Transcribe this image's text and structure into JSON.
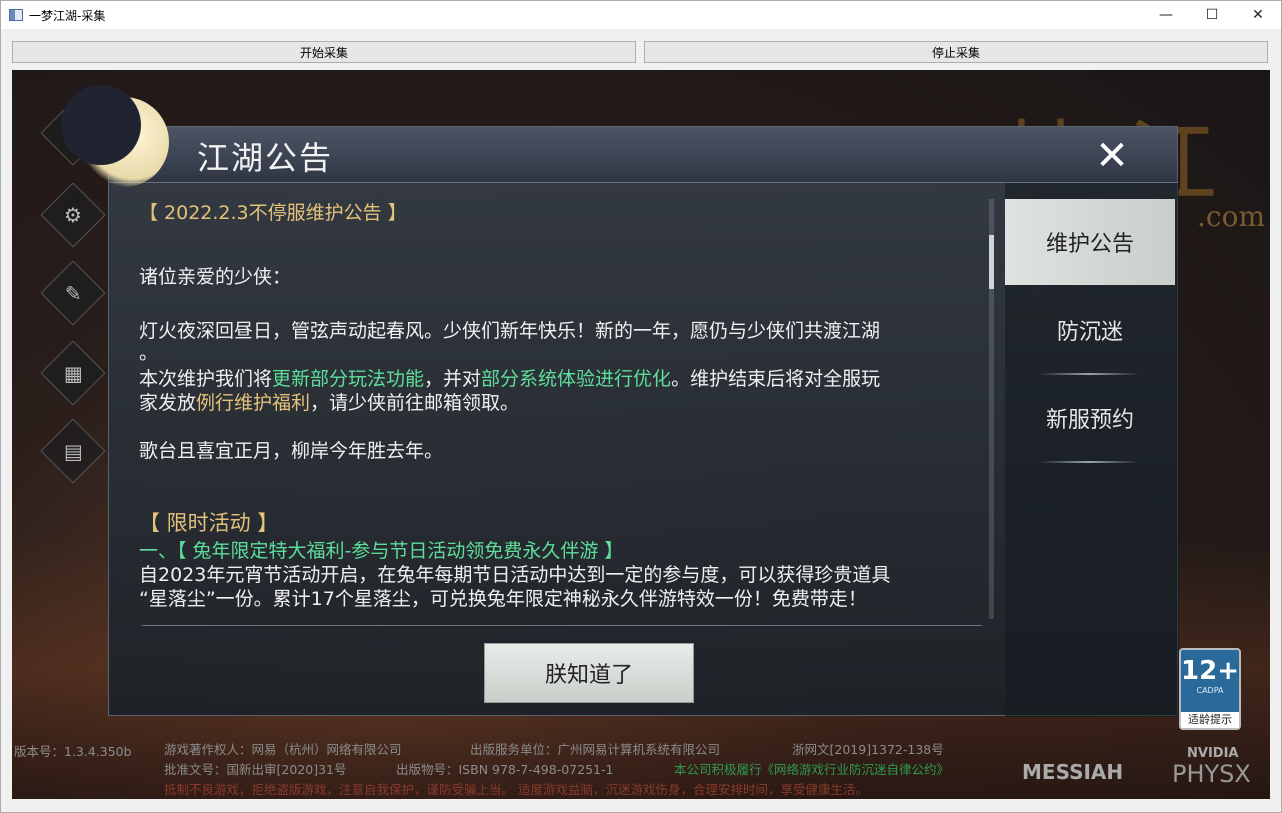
{
  "window": {
    "title": "一梦江湖-采集",
    "controls": [
      "—",
      "☐",
      "✕"
    ]
  },
  "toolbar": {
    "start_label": "开始采集",
    "stop_label": "停止采集"
  },
  "game": {
    "bg_logo": "梦江湖",
    "bg_com": ".com",
    "panel_title": "江湖公告",
    "close_label": "✕",
    "ok_label": "朕知道了",
    "tabs": [
      {
        "label": "维护公告",
        "active": true
      },
      {
        "label": "防沉迷",
        "active": false
      },
      {
        "label": "新服预约",
        "active": false
      }
    ],
    "notice": {
      "header": "【 2022.2.3不停服维护公告 】",
      "greeting": "诸位亲爱的少侠：",
      "para1": "灯火夜深回昼日，管弦声动起春风。少侠们新年快乐！新的一年，愿仍与少侠们共渡江湖",
      "para1_end": "。",
      "para2_a": "本次维护我们将",
      "para2_b": "更新部分玩法功能",
      "para2_c": "，并对",
      "para2_d": "部分系统体验进行优化",
      "para2_e": "。维护结束后将对全服玩",
      "para2_f": "家发放",
      "para2_g": "例行维护福利",
      "para2_h": "，请少侠前往邮箱领取。",
      "para3": "歌台且喜宜正月，柳岸今年胜去年。",
      "section": "【 限时活动 】",
      "sub": "一、【 兔年限定特大福利-参与节日活动领免费永久伴游 】",
      "body1": "自2023年元宵节活动开启，在兔年每期节日活动中达到一定的参与度，可以获得珍贵道具",
      "body2": "“星落尘”一份。累计17个星落尘，可兑换兔年限定神秘永久伴游特效一份！免费带走！"
    },
    "age_badge": {
      "num": "12+",
      "sub": "CADPA",
      "caption": "适龄提示"
    },
    "footer": {
      "version": "版本号：1.3.4.350b",
      "copyright": "游戏著作权人：网易（杭州）网络有限公司",
      "publisher": "出版服务单位：广州网易计算机系统有限公司",
      "license": "浙网文[2019]1372-138号",
      "approval": "批准文号：国新出审[2020]31号",
      "isbn": "出版物号：ISBN 978-7-498-07251-1",
      "pledge": "本公司积极履行《网络游戏行业防沉迷自律公约》",
      "warning": "抵制不良游戏，拒绝盗版游戏，注意自我保护，谨防受骗上当。 适度游戏益脑，沉迷游戏伤身，合理安排时间，享受健康生活。"
    },
    "logos": {
      "messiah": "MESSIAH",
      "nvidia": "NVIDIA",
      "physx": "PHYSX"
    }
  }
}
